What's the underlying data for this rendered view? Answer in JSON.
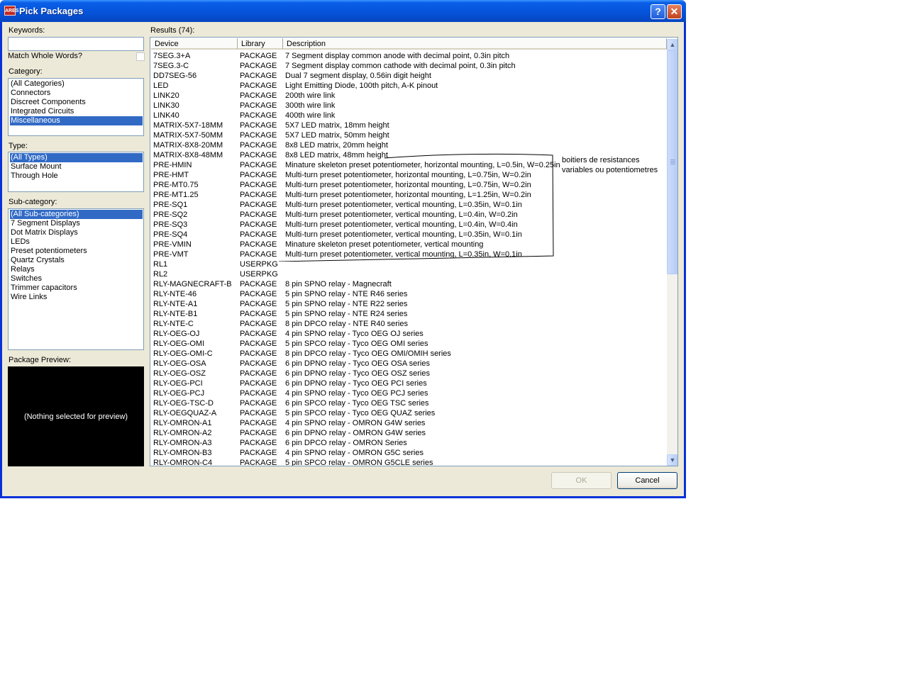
{
  "window": {
    "title": "Pick Packages",
    "app_badge": "ARES",
    "help_button": "?",
    "close_button": "✕"
  },
  "left": {
    "keywords_label": "Keywords:",
    "keywords_value": "",
    "match_whole_words_label": "Match Whole Words?",
    "match_whole_words_checked": false,
    "category_label": "Category:",
    "categories": [
      {
        "label": "(All Categories)",
        "selected": false
      },
      {
        "label": "Connectors",
        "selected": false
      },
      {
        "label": "Discreet Components",
        "selected": false
      },
      {
        "label": "Integrated Circuits",
        "selected": false
      },
      {
        "label": "Miscellaneous",
        "selected": true
      }
    ],
    "type_label": "Type:",
    "types": [
      {
        "label": "(All Types)",
        "selected": true
      },
      {
        "label": "Surface Mount",
        "selected": false
      },
      {
        "label": "Through Hole",
        "selected": false
      }
    ],
    "subcategory_label": "Sub-category:",
    "subcategories": [
      {
        "label": "(All Sub-categories)",
        "selected": true
      },
      {
        "label": "7 Segment Displays",
        "selected": false
      },
      {
        "label": "Dot Matrix Displays",
        "selected": false
      },
      {
        "label": "LEDs",
        "selected": false
      },
      {
        "label": "Preset potentiometers",
        "selected": false
      },
      {
        "label": "Quartz Crystals",
        "selected": false
      },
      {
        "label": "Relays",
        "selected": false
      },
      {
        "label": "Switches",
        "selected": false
      },
      {
        "label": "Trimmer capacitors",
        "selected": false
      },
      {
        "label": "Wire Links",
        "selected": false
      }
    ],
    "preview_label": "Package Preview:",
    "preview_text": "(Nothing selected for preview)"
  },
  "results": {
    "label": "Results (74):",
    "columns": [
      "Device",
      "Library",
      "Description"
    ],
    "rows": [
      [
        "7SEG.3+A",
        "PACKAGE",
        "7 Segment display common anode with decimal point, 0.3in pitch"
      ],
      [
        "7SEG.3-C",
        "PACKAGE",
        "7 Segment display common cathode with decimal point, 0.3in pitch"
      ],
      [
        "DD7SEG-56",
        "PACKAGE",
        "Dual 7 segment display, 0.56in digit height"
      ],
      [
        "LED",
        "PACKAGE",
        "Light Emitting Diode, 100th pitch, A-K pinout"
      ],
      [
        "LINK20",
        "PACKAGE",
        "200th wire link"
      ],
      [
        "LINK30",
        "PACKAGE",
        "300th wire link"
      ],
      [
        "LINK40",
        "PACKAGE",
        "400th wire link"
      ],
      [
        "MATRIX-5X7-18MM",
        "PACKAGE",
        "5X7 LED matrix, 18mm height"
      ],
      [
        "MATRIX-5X7-50MM",
        "PACKAGE",
        "5X7 LED matrix, 50mm height"
      ],
      [
        "MATRIX-8X8-20MM",
        "PACKAGE",
        "8x8 LED matrix, 20mm height"
      ],
      [
        "MATRIX-8X8-48MM",
        "PACKAGE",
        "8x8 LED matrix, 48mm height"
      ],
      [
        "PRE-HMIN",
        "PACKAGE",
        "Minature skeleton preset potentiometer, horizontal mounting, L=0.5in, W=0.25in"
      ],
      [
        "PRE-HMT",
        "PACKAGE",
        "Multi-turn preset potentiometer, horizontal mounting, L=0.75in, W=0.2in"
      ],
      [
        "PRE-MT0.75",
        "PACKAGE",
        "Multi-turn preset potentiometer, horizontal mounting, L=0.75in, W=0.2in"
      ],
      [
        "PRE-MT1.25",
        "PACKAGE",
        "Multi-turn preset potentiometer, horizontal mounting, L=1.25in, W=0.2in"
      ],
      [
        "PRE-SQ1",
        "PACKAGE",
        "Multi-turn preset potentiometer, vertical mounting, L=0.35in, W=0.1in"
      ],
      [
        "PRE-SQ2",
        "PACKAGE",
        "Multi-turn preset potentiometer, vertical mounting, L=0.4in, W=0.2in"
      ],
      [
        "PRE-SQ3",
        "PACKAGE",
        "Multi-turn preset potentiometer, vertical mounting, L=0.4in, W=0.4in"
      ],
      [
        "PRE-SQ4",
        "PACKAGE",
        "Multi-turn preset potentiometer, vertical mounting, L=0.35in, W=0.1in"
      ],
      [
        "PRE-VMIN",
        "PACKAGE",
        "Minature skeleton preset potentiometer, vertical mounting"
      ],
      [
        "PRE-VMT",
        "PACKAGE",
        "Multi-turn preset potentiometer, vertical mounting, L=0.35in, W=0.1in"
      ],
      [
        "RL1",
        "USERPKG",
        ""
      ],
      [
        "RL2",
        "USERPKG",
        ""
      ],
      [
        "RLY-MAGNECRAFT-B",
        "PACKAGE",
        "8 pin SPNO relay - Magnecraft"
      ],
      [
        "RLY-NTE-46",
        "PACKAGE",
        "5 pin SPNO relay - NTE R46 series"
      ],
      [
        "RLY-NTE-A1",
        "PACKAGE",
        "5 pin SPNO relay - NTE R22 series"
      ],
      [
        "RLY-NTE-B1",
        "PACKAGE",
        "5 pin SPNO relay - NTE R24 series"
      ],
      [
        "RLY-NTE-C",
        "PACKAGE",
        "8 pin DPCO relay - NTE R40 series"
      ],
      [
        "RLY-OEG-OJ",
        "PACKAGE",
        "4 pin SPNO relay - Tyco OEG OJ series"
      ],
      [
        "RLY-OEG-OMI",
        "PACKAGE",
        "5 pin SPCO relay - Tyco OEG OMI series"
      ],
      [
        "RLY-OEG-OMI-C",
        "PACKAGE",
        "8 pin DPCO relay - Tyco OEG OMI/OMIH series"
      ],
      [
        "RLY-OEG-OSA",
        "PACKAGE",
        "6 pin DPNO relay - Tyco OEG OSA series"
      ],
      [
        "RLY-OEG-OSZ",
        "PACKAGE",
        "6 pin DPNO relay - Tyco OEG OSZ series"
      ],
      [
        "RLY-OEG-PCI",
        "PACKAGE",
        "6 pin DPNO relay - Tyco OEG PCI series"
      ],
      [
        "RLY-OEG-PCJ",
        "PACKAGE",
        "4 pin SPNO relay - Tyco OEG PCJ series"
      ],
      [
        "RLY-OEG-TSC-D",
        "PACKAGE",
        "6 pin SPCO relay - Tyco OEG TSC series"
      ],
      [
        "RLY-OEGQUAZ-A",
        "PACKAGE",
        "5 pin SPCO relay - Tyco OEG QUAZ series"
      ],
      [
        "RLY-OMRON-A1",
        "PACKAGE",
        "4 pin SPNO relay - OMRON G4W series"
      ],
      [
        "RLY-OMRON-A2",
        "PACKAGE",
        "6 pin DPNO relay - OMRON G4W series"
      ],
      [
        "RLY-OMRON-A3",
        "PACKAGE",
        "6 pin DPCO relay - OMRON Series"
      ],
      [
        "RLY-OMRON-B3",
        "PACKAGE",
        "4 pin SPNO relay - OMRON G5C series"
      ],
      [
        "RLY-OMRON-C4",
        "PACKAGE",
        "5 pin SPCO relay - OMRON G5CLE series"
      ]
    ],
    "annotation": "boitiers de resistances variables ou potentiometres"
  },
  "buttons": {
    "ok": "OK",
    "cancel": "Cancel",
    "ok_enabled": false
  },
  "colors": {
    "selection": "#316ac5",
    "titlebar": "#0552d8",
    "dialog_bg": "#ece9d8"
  }
}
